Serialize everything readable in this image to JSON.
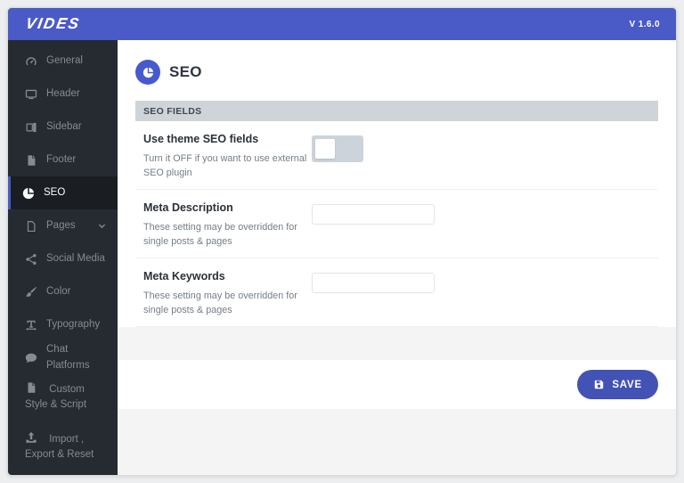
{
  "topbar": {
    "logo": "VIDES",
    "version": "V 1.6.0"
  },
  "sidebar": {
    "items": [
      {
        "label": "General",
        "icon": "gauge-icon",
        "active": false
      },
      {
        "label": "Header",
        "icon": "monitor-icon",
        "active": false
      },
      {
        "label": "Sidebar",
        "icon": "columns-icon",
        "active": false
      },
      {
        "label": "Footer",
        "icon": "file-icon",
        "active": false
      },
      {
        "label": "SEO",
        "icon": "pie-chart-icon",
        "active": true
      },
      {
        "label": "Pages",
        "icon": "page-icon",
        "active": false,
        "chevron": "chevron-down-icon"
      },
      {
        "label": "Social Media",
        "icon": "share-icon",
        "active": false
      },
      {
        "label": "Color",
        "icon": "brush-icon",
        "active": false
      },
      {
        "label": "Typography",
        "icon": "text-width-icon",
        "active": false
      },
      {
        "label": "Chat Platforms",
        "icon": "comment-icon",
        "active": false
      },
      {
        "label": "Custom Style & Script",
        "icon": "file-icon",
        "active": false
      },
      {
        "label": "Import , Export & Reset",
        "icon": "upload-icon",
        "active": false
      }
    ]
  },
  "page": {
    "title": "SEO",
    "icon": "pie-chart-icon"
  },
  "section": {
    "header": "SEO FIELDS",
    "rows": [
      {
        "label": "Use theme SEO fields",
        "description": "Turn it OFF if you want to use external SEO plugin",
        "control": "toggle",
        "toggle_state": "knob-left"
      },
      {
        "label": "Meta Description",
        "description": "These setting may be overridden for single posts & pages",
        "control": "input",
        "value": ""
      },
      {
        "label": "Meta Keywords",
        "description": "These setting may be overridden for single posts & pages",
        "control": "input",
        "value": ""
      }
    ]
  },
  "footer": {
    "save_label": "SAVE",
    "save_icon": "save-icon"
  },
  "colors": {
    "accent_blue": "#4a5ac6",
    "save_button_blue": "#4252b5",
    "page_icon_blue": "#4659cf",
    "sidebar_bg": "#262b31",
    "sidebar_active_bg": "#1a1e23",
    "fields_header_bg": "#cfd4d9",
    "toggle_track": "#ccd3db",
    "main_bg": "#f4f4f5"
  }
}
